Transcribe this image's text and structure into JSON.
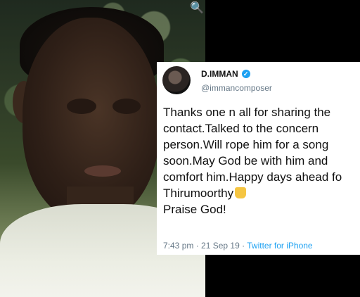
{
  "tweet": {
    "display_name": "D.IMMAN",
    "handle": "@immancomposer",
    "lines": [
      "Thanks one n all for sharing the",
      "contact.Talked to the concern",
      "person.Will rope him for a song",
      "soon.May God be with him and",
      "comfort him.Happy days ahead fo",
      "Thirumoorthy",
      "Praise God!"
    ],
    "emoji": "thumbs-up",
    "time": "7:43 pm",
    "date": "21 Sep 19",
    "separator": "·",
    "source": "Twitter for iPhone"
  },
  "icons": {
    "zoom": "zoom-icon",
    "verified": "verified-icon"
  },
  "colors": {
    "verified": "#1da1f2",
    "handle": "#657786",
    "source_link": "#1da1f2"
  }
}
